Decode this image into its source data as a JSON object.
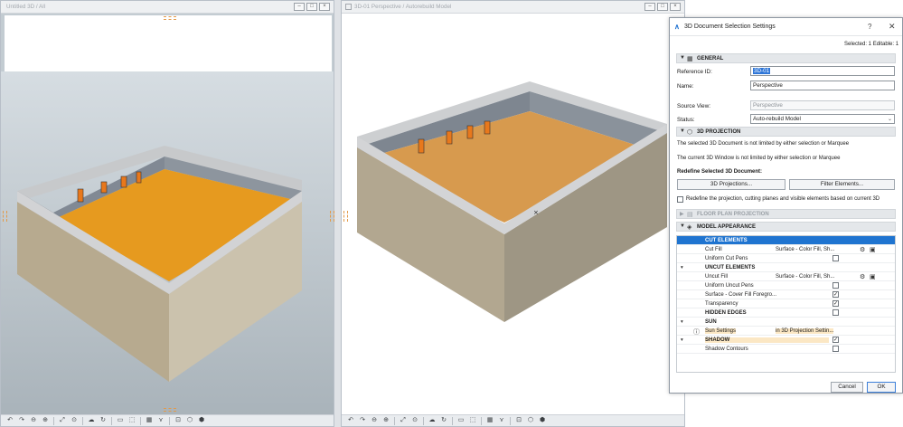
{
  "window1": {
    "title": "Untitled 3D / All",
    "buttons": [
      "–",
      "□",
      "×"
    ]
  },
  "window2": {
    "title": "3D-01 Perspective / Autorebuild Model",
    "buttons": [
      "–",
      "□",
      "×"
    ]
  },
  "toolbar_icons": [
    "↶",
    "↷",
    "⊖",
    "⊕",
    "⤢",
    "⊙",
    "☁",
    "↻",
    "▭",
    "⬚",
    "▦",
    "⋎",
    "⊡",
    "⬡",
    "⬢"
  ],
  "dialog": {
    "title": "3D Document Selection Settings",
    "help": "?",
    "close": "✕",
    "selection_info": "Selected: 1 Editable: 1",
    "general": {
      "header": "GENERAL",
      "reference_id_label": "Reference ID:",
      "reference_id_value": "3D-01",
      "name_label": "Name:",
      "name_value": "Perspective",
      "source_view_label": "Source View:",
      "source_view_value": "Perspective",
      "status_label": "Status:",
      "status_value": "Auto-rebuild Model"
    },
    "projection": {
      "header": "3D PROJECTION",
      "info1": "The selected 3D Document is not limited by either selection or Marquee",
      "info2": "The current 3D Window is not limited by either selection or Marquee",
      "redefine_label": "Redefine Selected 3D Document:",
      "btn_projections": "3D Projections...",
      "btn_filter": "Filter Elements...",
      "redefine_checkbox": "Redefine the projection, cutting planes and visible elements based on current 3D"
    },
    "floor_plan_header": "FLOOR PLAN PROJECTION",
    "model_appearance": {
      "header": "MODEL APPEARANCE",
      "rows": [
        {
          "label": "CUT ELEMENTS",
          "value": "",
          "check": "",
          "group": true,
          "selected": true,
          "expand": ""
        },
        {
          "label": "Cut Fill",
          "value": "Surface - Color Fill, Sh...",
          "check": "",
          "group": false,
          "selected": false,
          "expand": ""
        },
        {
          "label": "Uniform Cut Pens",
          "value": "",
          "check": "",
          "group": false,
          "selected": false,
          "expand": ""
        },
        {
          "label": "UNCUT ELEMENTS",
          "value": "",
          "check": "",
          "group": true,
          "selected": false,
          "expand": "▾"
        },
        {
          "label": "Uncut Fill",
          "value": "Surface - Color Fill, Sh...",
          "check": "",
          "group": false,
          "selected": false,
          "expand": ""
        },
        {
          "label": "Uniform Uncut Pens",
          "value": "",
          "check": "",
          "group": false,
          "selected": false,
          "expand": ""
        },
        {
          "label": "Surface - Cover Fill Foregro...",
          "value": "",
          "check": "✓",
          "group": false,
          "selected": false,
          "expand": ""
        },
        {
          "label": "Transparency",
          "value": "",
          "check": "✓",
          "group": false,
          "selected": false,
          "expand": ""
        },
        {
          "label": "HIDDEN EDGES",
          "value": "",
          "check": "",
          "group": true,
          "selected": false,
          "expand": ""
        },
        {
          "label": "SUN",
          "value": "",
          "check": "",
          "group": true,
          "selected": false,
          "expand": "▾"
        },
        {
          "label": "Sun Settings",
          "value": "in 3D Projection Settin...",
          "check": "",
          "group": false,
          "selected": false,
          "expand": ""
        },
        {
          "label": "SHADOW",
          "value": "",
          "check": "✓",
          "group": true,
          "selected": false,
          "expand": "▾"
        },
        {
          "label": "Shadow Contours",
          "value": "",
          "check": "",
          "group": false,
          "selected": false,
          "expand": ""
        }
      ]
    },
    "cancel_label": "Cancel",
    "ok_label": "OK"
  },
  "colors": {
    "floor": "#e69a1f",
    "wall_outer": "#b5a88e",
    "wall_inner": "#868e98",
    "selection": "#1f74d0",
    "highlight": "#fbe7c4"
  }
}
